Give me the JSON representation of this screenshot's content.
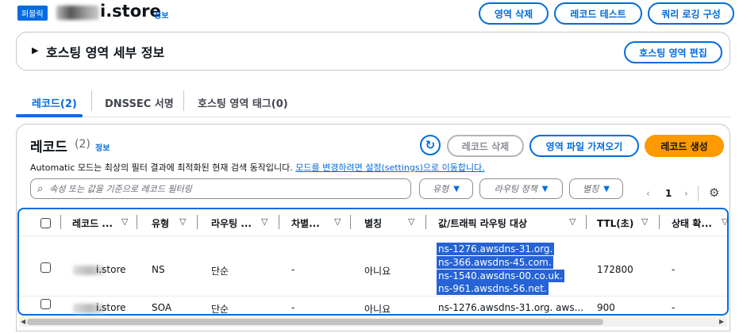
{
  "header": {
    "badge": "퍼블릭",
    "zone_name": "i.store",
    "info_label": "정보",
    "buttons": {
      "delete_zone": "영역 삭제",
      "test_record": "레코드 테스트",
      "query_logging": "쿼리 로깅 구성"
    }
  },
  "details": {
    "title": "호스팅 영역 세부 정보",
    "edit_button": "호스팅 영역 편집"
  },
  "tabs": [
    {
      "label": "레코드(2)",
      "active": true
    },
    {
      "label": "DNSSEC 서명",
      "active": false
    },
    {
      "label": "호스팅 영역 태그(0)",
      "active": false
    }
  ],
  "records": {
    "title": "레코드",
    "count": "(2)",
    "info_label": "정보",
    "delete_button": "레코드 삭제",
    "import_button": "영역 파일 가져오기",
    "create_button": "레코드 생성",
    "description": "Automatic 모드는 최상의 필터 결과에 최적화된 현재 검색 동작입니다.",
    "description_link": "모드를 변경하려면 설정(settings)으로 이동합니다.",
    "search_placeholder": "속성 또는 값을 기준으로 레코드 필터링",
    "filters": [
      "유형",
      "라우팅 정책",
      "별칭"
    ],
    "pagination": {
      "current": "1"
    }
  },
  "table": {
    "columns": [
      "레코드 ...",
      "유형",
      "라우팅 ...",
      "차별...",
      "별칭",
      "값/트래픽 라우팅 대상",
      "TTL(초)",
      "상태 확..."
    ],
    "rows": [
      {
        "name": "i.store",
        "type": "NS",
        "routing": "단순",
        "differentiator": "-",
        "alias": "아니요",
        "values": [
          "ns-1276.awsdns-31.org.",
          "ns-366.awsdns-45.com.",
          "ns-1540.awsdns-00.co.uk.",
          "ns-961.awsdns-56.net."
        ],
        "ttl": "172800",
        "health": "-"
      },
      {
        "name": "i.store",
        "type": "SOA",
        "routing": "단순",
        "differentiator": "-",
        "alias": "아니요",
        "value": "ns-1276.awsdns-31.org. aws...",
        "ttl": "900",
        "health": "-"
      }
    ]
  },
  "colors": {
    "accent": "#006ce0",
    "primary": "#ff9900",
    "highlight": "#2563d6"
  }
}
